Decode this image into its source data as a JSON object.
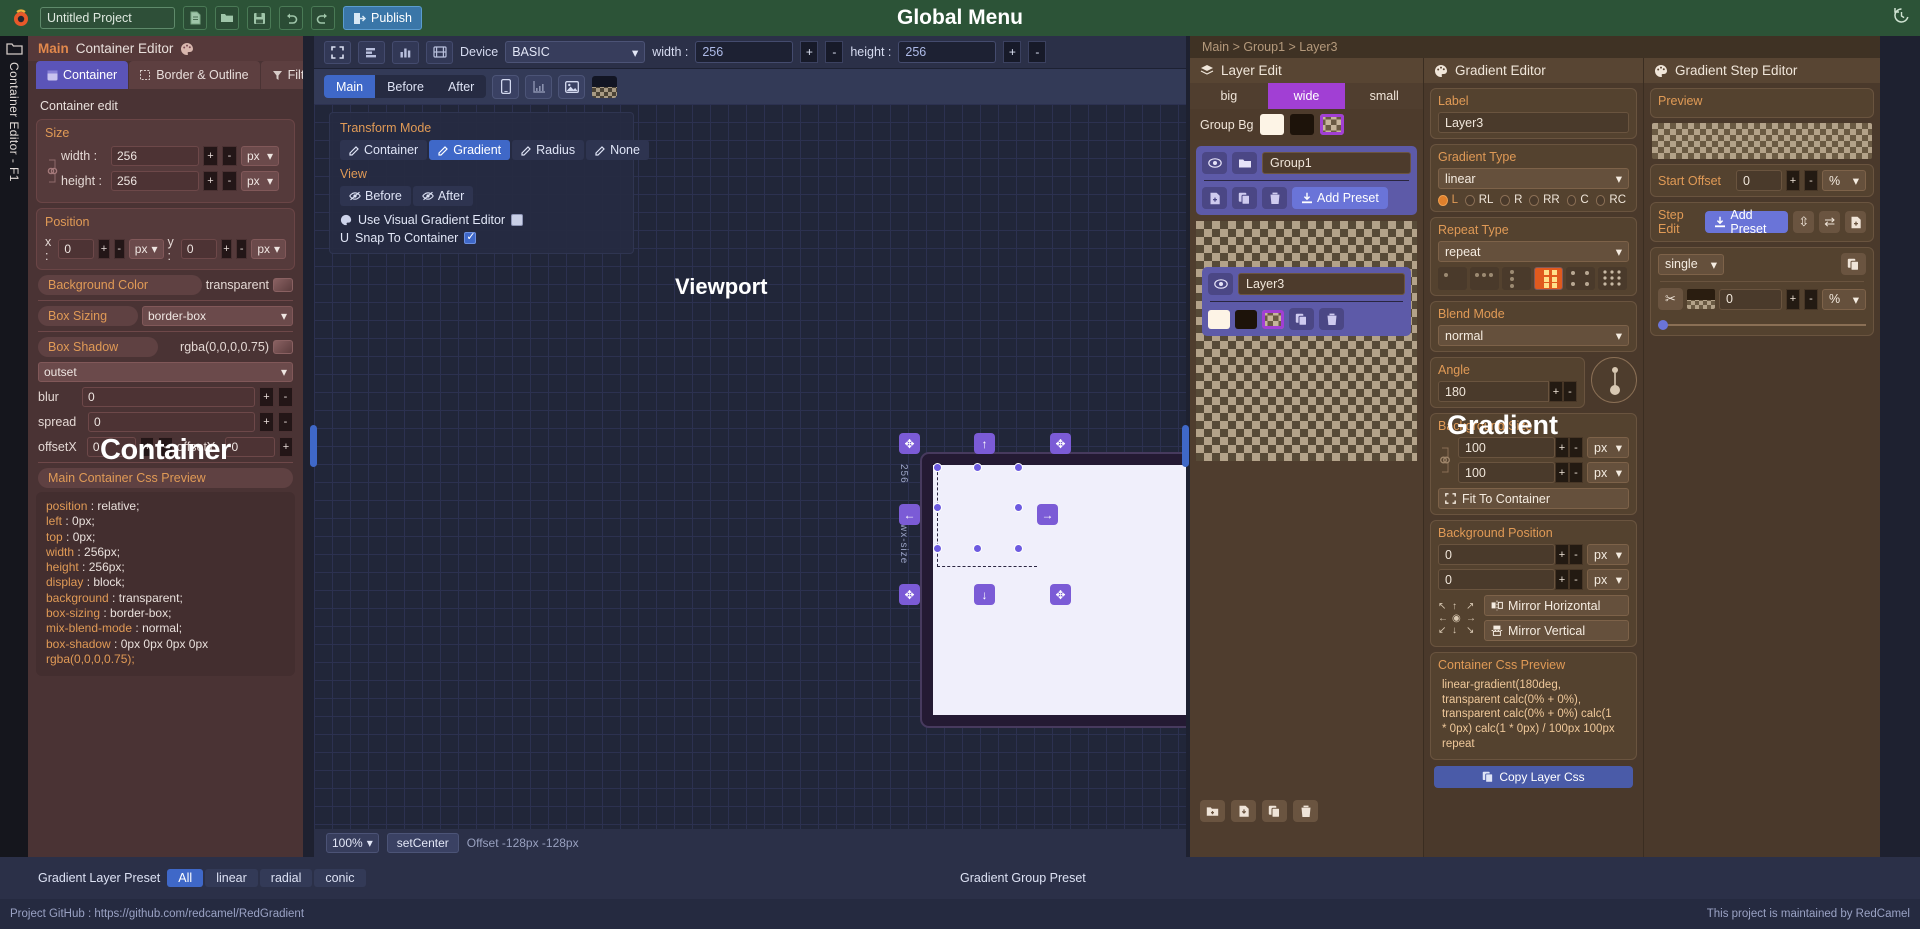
{
  "topbar": {
    "project_name": "Untitled Project",
    "title": "Global Menu",
    "publish_label": "Publish",
    "buttons": [
      "new-file",
      "open-folder",
      "save",
      "undo",
      "redo"
    ]
  },
  "left_rail": {
    "vertical_label": "Container Editor - F1"
  },
  "left_panel": {
    "header_main": "Main",
    "header_title": "Container Editor",
    "tabs": [
      {
        "label": "Container",
        "active": true
      },
      {
        "label": "Border & Outline",
        "active": false
      },
      {
        "label": "Filter",
        "active": false
      }
    ],
    "section_title": "Container edit",
    "size": {
      "title": "Size",
      "width_label": "width :",
      "width_value": "256",
      "width_unit": "px",
      "height_label": "height :",
      "height_value": "256",
      "height_unit": "px"
    },
    "position": {
      "title": "Position",
      "x_label": "x :",
      "x_value": "0",
      "x_unit": "px",
      "y_label": "y :",
      "y_value": "0",
      "y_unit": "px"
    },
    "background_color": {
      "label": "Background Color",
      "value": "transparent"
    },
    "box_sizing": {
      "label": "Box Sizing",
      "value": "border-box"
    },
    "box_shadow": {
      "label": "Box Shadow",
      "value": "rgba(0,0,0,0.75)",
      "type": "outset",
      "blur_label": "blur",
      "blur_value": "0",
      "spread_label": "spread",
      "spread_value": "0",
      "offsetx_label": "offsetX",
      "offsetx_value": "0",
      "offsety_label": "offsetY",
      "offsety_value": "0"
    },
    "css_preview": {
      "title": "Main Container Css Preview",
      "lines": [
        {
          "k": "position",
          "v": "relative;"
        },
        {
          "k": "left",
          "v": "0px;"
        },
        {
          "k": "top",
          "v": "0px;"
        },
        {
          "k": "width",
          "v": "256px;"
        },
        {
          "k": "height",
          "v": "256px;"
        },
        {
          "k": "display",
          "v": "block;"
        },
        {
          "k": "background",
          "v": "transparent;"
        },
        {
          "k": "box-sizing",
          "v": "border-box;"
        },
        {
          "k": "mix-blend-mode",
          "v": "normal;"
        },
        {
          "k": "box-shadow",
          "v": "0px 0px 0px 0px"
        }
      ],
      "last_line": "rgba(0,0,0,0.75);"
    },
    "watermark": "Container"
  },
  "center": {
    "toolbar": {
      "device_label": "Device",
      "device_value": "BASIC",
      "width_label": "width :",
      "width_value": "256",
      "height_label": "height :",
      "height_value": "256"
    },
    "tabs": [
      {
        "label": "Main",
        "active": true
      },
      {
        "label": "Before",
        "active": false
      },
      {
        "label": "After",
        "active": false
      }
    ],
    "viewport_title": "Viewport",
    "transform_mode": {
      "title": "Transform Mode",
      "buttons": [
        {
          "label": "Container",
          "active": false
        },
        {
          "label": "Gradient",
          "active": true
        },
        {
          "label": "Radius",
          "active": false
        },
        {
          "label": "None",
          "active": false
        }
      ],
      "view_title": "View",
      "view_buttons": [
        {
          "label": "Before"
        },
        {
          "label": "After"
        }
      ],
      "visual_gradient_label": "Use Visual Gradient Editor",
      "visual_gradient_checked": false,
      "snap_label": "Snap To Container",
      "snap_checked": true
    },
    "ruler_label": "256",
    "ruler_label2": "wx-size",
    "bottom": {
      "zoom": "100%",
      "setcenter_label": "setCenter",
      "offset_text": "Offset -128px -128px"
    }
  },
  "right": {
    "breadcrumb": "Main > Group1 > Layer3",
    "layer_edit": {
      "title": "Layer Edit",
      "size_tabs": [
        {
          "label": "big",
          "active": false
        },
        {
          "label": "wide",
          "active": true
        },
        {
          "label": "small",
          "active": false
        }
      ],
      "group_bg_label": "Group Bg",
      "group_name": "Group1",
      "add_preset_label": "Add Preset",
      "layer_name": "Layer3"
    },
    "gradient_editor": {
      "title": "Gradient Editor",
      "label_title": "Label",
      "label_value": "Layer3",
      "gradient_type_title": "Gradient Type",
      "gradient_type_value": "linear",
      "direction_options": [
        {
          "label": "L",
          "on": true
        },
        {
          "label": "RL",
          "on": false
        },
        {
          "label": "R",
          "on": false
        },
        {
          "label": "RR",
          "on": false
        },
        {
          "label": "C",
          "on": false
        },
        {
          "label": "RC",
          "on": false
        }
      ],
      "repeat_type_title": "Repeat Type",
      "repeat_type_value": "repeat",
      "blend_mode_title": "Blend Mode",
      "blend_mode_value": "normal",
      "angle_title": "Angle",
      "angle_value": "180",
      "background_size_title": "Background Size",
      "background_size_w": "100",
      "background_size_h": "100",
      "background_size_unit": "px",
      "fit_to_container_label": "Fit To Container",
      "background_position_title": "Background Position",
      "background_position_x": "0",
      "background_position_y": "0",
      "background_position_unit": "px",
      "mirror_horizontal_label": "Mirror Horizontal",
      "mirror_vertical_label": "Mirror Vertical",
      "css_preview_title": "Container Css Preview",
      "css_lines": [
        "linear-gradient(180deg,",
        "transparent calc(0% + 0%),",
        "transparent calc(0% + 0%) calc(1",
        "* 0px) calc(1 * 0px) / 100px 100px",
        "repeat"
      ],
      "copy_css_label": "Copy Layer Css",
      "watermark": "Gradient"
    },
    "step_editor": {
      "title": "Gradient Step Editor",
      "preview_title": "Preview",
      "start_offset_label": "Start Offset",
      "start_offset_value": "0",
      "start_offset_unit": "%",
      "step_edit_label": "Step Edit",
      "add_preset_label": "Add Preset",
      "mode_value": "single",
      "step_value": "0",
      "step_unit": "%"
    }
  },
  "bottombar": {
    "gradient_layer_preset_label": "Gradient Layer Preset",
    "filters": [
      {
        "label": "All",
        "active": true
      },
      {
        "label": "linear",
        "active": false
      },
      {
        "label": "radial",
        "active": false
      },
      {
        "label": "conic",
        "active": false
      }
    ],
    "gradient_group_preset_label": "Gradient Group Preset"
  },
  "statusbar": {
    "left": "Project GitHub : https://github.com/redcamel/RedGradient",
    "right": "This project is maintained by RedCamel"
  },
  "colors": {
    "accent_blue": "#3f68c8",
    "accent_purple": "#a13fd4",
    "accent_orange": "#e09a56",
    "topbar_green": "#2c5337"
  }
}
